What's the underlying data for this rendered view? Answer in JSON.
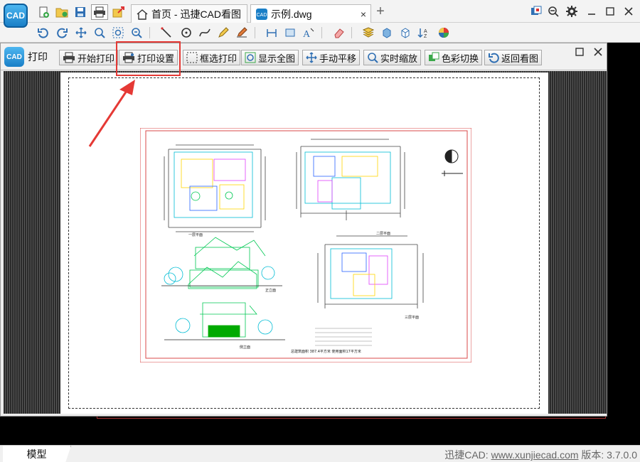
{
  "app": {
    "logo_text": "CAD",
    "tabs": [
      {
        "label": "首页 - 迅捷CAD看图"
      },
      {
        "label": "示例.dwg",
        "close": "×"
      }
    ],
    "new_tab": "+"
  },
  "print_panel": {
    "title": "打印",
    "logo_text": "CAD",
    "buttons": [
      {
        "label": "开始打印"
      },
      {
        "label": "打印设置"
      },
      {
        "label": "框选打印"
      },
      {
        "label": "显示全图"
      },
      {
        "label": "手动平移"
      },
      {
        "label": "实时缩放"
      },
      {
        "label": "色彩切换"
      },
      {
        "label": "返回看图"
      }
    ],
    "highlighted_button": "打印设置"
  },
  "drawing": {
    "captions": [
      "一层平面",
      "二层平面",
      "三层平面",
      "正立面",
      "侧立面"
    ],
    "footer_note": "总建筑面积    387.4平方米    使用面积17平方米"
  },
  "status": {
    "model_tab": "模型",
    "brand": "迅捷CAD: ",
    "url": "www.xunjiecad.com",
    "version": " 版本: 3.7.0.0"
  },
  "colors": {
    "accent": "#1a7fc7",
    "highlight": "#e53935",
    "drawing_frame": "#d84a4a"
  }
}
